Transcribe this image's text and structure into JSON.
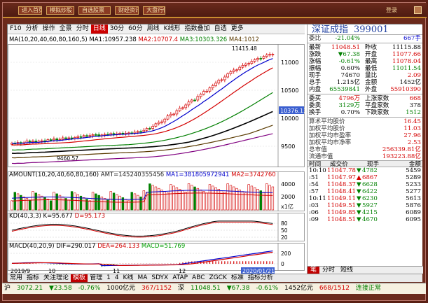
{
  "top_buttons": [
    "进入首页",
    "模拟炒股",
    "自选股票",
    "财经资讯",
    "大盘行情"
  ],
  "top_right_label": "登录",
  "toolbar": {
    "items": [
      "F10",
      "分析",
      "操作",
      "全景",
      "分时",
      "日线",
      "30分",
      "60分",
      "周线",
      "K线形",
      "指数叠加",
      "自选",
      "更多"
    ],
    "active_index": 5
  },
  "main_panel": {
    "ma_title": "MA(10,20,40,60,80,160,5)",
    "ma1": "MA1:10957.238",
    "ma2": "MA2:10707.4",
    "ma3": "MA3:10303.326",
    "ma4": "MA4:1012",
    "high_label": "11415.48",
    "low_label": "9460.57",
    "marker_label": "10376.13",
    "y_ticks": [
      "11000",
      "10500",
      "10000",
      "9500"
    ]
  },
  "amount_panel": {
    "title": "AMOUNT",
    "params": "(10,20,40,60,80,160)",
    "amt": "AMT=145240355456",
    "ma1": "MA1=381805972941",
    "ma2": "MA2=3742760",
    "y_ticks": [
      "4000",
      "2000"
    ],
    "unit": "x1亿"
  },
  "kd_panel": {
    "title": "KD",
    "params": "(40,3,3)",
    "k": "K=95.677",
    "d": "D=95.173",
    "y_ticks": [
      "80",
      "50",
      "20"
    ]
  },
  "macd_panel": {
    "title": "MACD",
    "params": "(40,20,9)",
    "dif": "DIF=290.017",
    "dea": "DEA=264.133",
    "macd": "MACD=51.769",
    "y_ticks": [
      "200",
      "0",
      "-200"
    ]
  },
  "x_axis_labels": [
    "2019/9",
    "10",
    "11",
    "12",
    "2020/01/21"
  ],
  "bottom_tabs": [
    "常用",
    "指标",
    "关注理论",
    "模板",
    "管理",
    "1",
    "4",
    "K线",
    "MA",
    "SDYX",
    "ATAP",
    "ABC",
    "ZGCK",
    "标准",
    "指标分析"
  ],
  "bottom_tab_selected": 3,
  "quote": {
    "name": "深证成指",
    "code": "399001",
    "weibi_label": "委比",
    "weibi": "-21.04%",
    "weicha": "667手",
    "rows": [
      {
        "k1": "最新",
        "v1": "11048.51",
        "k2": "昨收",
        "v2": "11115.88",
        "c1": "red",
        "c2": "black"
      },
      {
        "k1": "涨跌",
        "v1": "▼67.38",
        "k2": "开盘",
        "v2": "11077.66",
        "c1": "green",
        "c2": "red"
      },
      {
        "k1": "涨幅",
        "v1": "-0.61%",
        "k2": "最高",
        "v2": "11078.04",
        "c1": "green",
        "c2": "red"
      },
      {
        "k1": "振幅",
        "v1": "0.60%",
        "k2": "最低",
        "v2": "11011.54",
        "c1": "black",
        "c2": "green"
      },
      {
        "k1": "现手",
        "v1": "74670",
        "k2": "量比",
        "v2": "2.09",
        "c1": "black",
        "c2": "red"
      },
      {
        "k1": "总手",
        "v1": "1.215亿",
        "k2": "金额",
        "v2": "1452亿",
        "c1": "black",
        "c2": "black"
      },
      {
        "k1": "内盘",
        "v1": "65539841",
        "k2": "外盘",
        "v2": "55910390",
        "c1": "green",
        "c2": "red"
      }
    ],
    "rows2": [
      {
        "k1": "委买",
        "v1": "4796万",
        "k2": "上涨家数",
        "v2": "668",
        "c1": "red",
        "c2": "red"
      },
      {
        "k1": "委卖",
        "v1": "3129万",
        "k2": "平盘家数",
        "v2": "378",
        "c1": "green",
        "c2": "black"
      },
      {
        "k1": "换手",
        "v1": "0.70%",
        "k2": "下跌家数",
        "v2": "1512",
        "c1": "black",
        "c2": "green"
      }
    ],
    "stats": [
      {
        "k": "算术平均股价",
        "v": "16.45",
        "c": "red"
      },
      {
        "k": "加权平均股价",
        "v": "11.03",
        "c": "red"
      },
      {
        "k": "加权平均市盈率",
        "v": "27.96",
        "c": "red"
      },
      {
        "k": "加权平均市净率",
        "v": "2.53",
        "c": "red"
      },
      {
        "k": "总市值",
        "v": "256339.81亿",
        "c": "red"
      },
      {
        "k": "流通市值",
        "v": "193223.88亿",
        "c": "red"
      }
    ],
    "trades_head": [
      "时间",
      "成交价",
      "现手",
      "金额"
    ],
    "trades": [
      {
        "t": "10:10",
        "p": "11047.78",
        "arrow": "▼",
        "vol": "4782",
        "amt": "5459",
        "dir": "down"
      },
      {
        "t": ":51",
        "p": "11047.97",
        "arrow": "▲",
        "vol": "6867",
        "amt": "5289",
        "dir": "up"
      },
      {
        "t": ":54",
        "p": "11048.37",
        "arrow": "▼",
        "vol": "6628",
        "amt": "5233",
        "dir": "down"
      },
      {
        "t": ":57",
        "p": "11048.41",
        "arrow": "▼",
        "vol": "6422",
        "amt": "5277",
        "dir": "down"
      },
      {
        "t": "10:11",
        "p": "11049.11",
        "arrow": "▼",
        "vol": "6230",
        "amt": "5613",
        "dir": "down"
      },
      {
        "t": ":03",
        "p": "11049.51",
        "arrow": "▼",
        "vol": "5927",
        "amt": "5876",
        "dir": "down"
      },
      {
        "t": ":06",
        "p": "11049.85",
        "arrow": "▼",
        "vol": "4215",
        "amt": "6089",
        "dir": "down"
      },
      {
        "t": ":09",
        "p": "11048.51",
        "arrow": "▼",
        "vol": "4670",
        "amt": "6095",
        "dir": "down"
      }
    ],
    "side_tabs": [
      "笔",
      "分",
      "价",
      "细",
      "势",
      "联"
    ],
    "side_tab_selected": 0,
    "side_tab_labels": [
      "分时",
      "短线"
    ]
  },
  "status": {
    "label1": "沪",
    "v1": "3072.21",
    "c1": "▼23.58",
    "p1": "-0.76%",
    "a1": "1000亿元",
    "n1": "367/1152",
    "label2": "深",
    "v2": "11048.51",
    "c2": "▼67.38",
    "p2": "-0.61%",
    "a2": "1452亿元",
    "n2": "668/1512",
    "conn": "连接正常"
  }
}
